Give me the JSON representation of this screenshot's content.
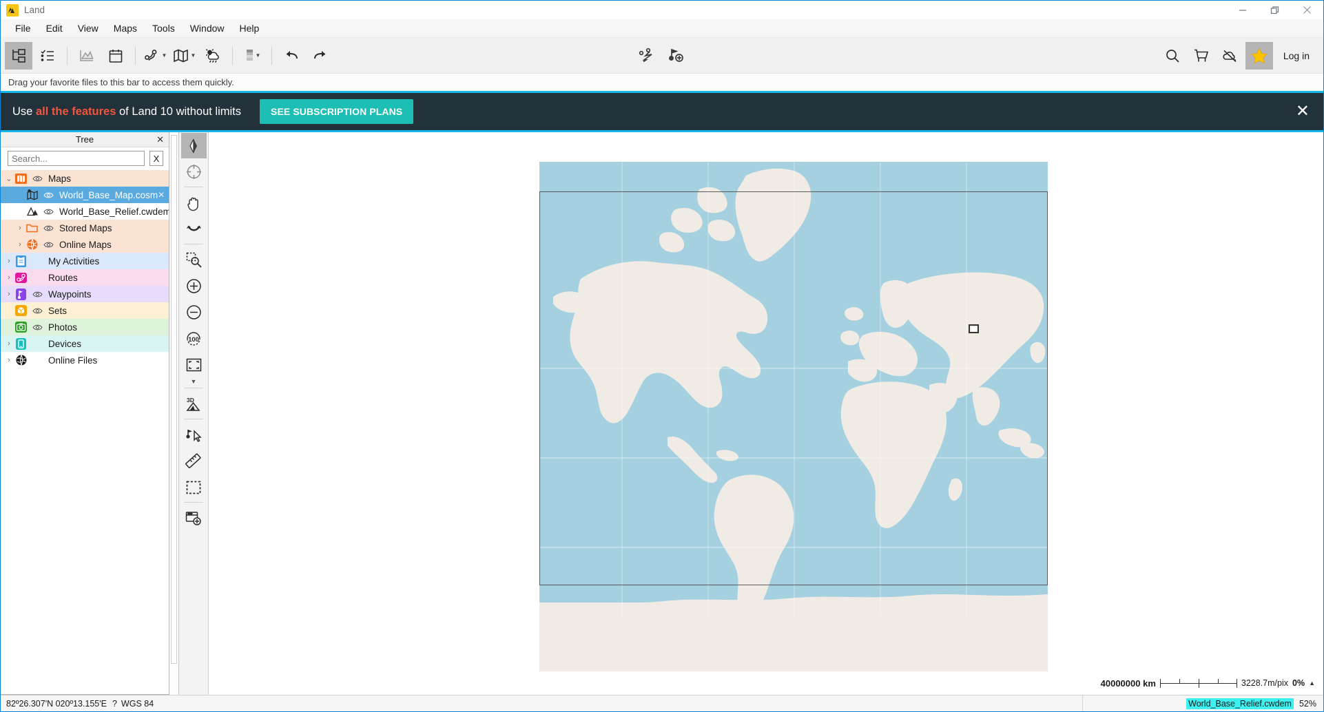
{
  "window": {
    "title": "Land",
    "app_icon": "land-mountain-icon",
    "controls": {
      "minimize": "—",
      "maximize": "❐",
      "close": "✕"
    }
  },
  "menubar": {
    "items": [
      {
        "label": "File",
        "name": "menu-file"
      },
      {
        "label": "Edit",
        "name": "menu-edit"
      },
      {
        "label": "View",
        "name": "menu-view"
      },
      {
        "label": "Maps",
        "name": "menu-maps"
      },
      {
        "label": "Tools",
        "name": "menu-tools"
      },
      {
        "label": "Window",
        "name": "menu-window"
      },
      {
        "label": "Help",
        "name": "menu-help"
      }
    ]
  },
  "toolbar": {
    "left": [
      {
        "icon": "tree-panel-icon",
        "active": true
      },
      {
        "icon": "checklist-icon",
        "active": false
      },
      {
        "icon": "elevation-graph-icon",
        "active": false
      },
      {
        "icon": "calendar-icon",
        "active": false
      },
      {
        "icon": "route-icon",
        "active": false,
        "caret": true
      },
      {
        "icon": "map-fold-icon",
        "active": false,
        "caret": true
      },
      {
        "icon": "weather-icon",
        "active": false
      },
      {
        "icon": "layers-opacity-icon",
        "active": false,
        "caret": true
      },
      {
        "icon": "undo-icon",
        "active": false
      },
      {
        "icon": "redo-icon",
        "active": false
      }
    ],
    "center": [
      {
        "icon": "create-route-icon"
      },
      {
        "icon": "add-waypoint-icon"
      }
    ],
    "right": [
      {
        "icon": "search-icon"
      },
      {
        "icon": "cart-icon"
      },
      {
        "icon": "cloud-offline-icon"
      },
      {
        "icon": "star-icon",
        "active": true
      }
    ],
    "login_label": "Log in"
  },
  "favbar": {
    "hint": "Drag your favorite files to this bar to access them quickly."
  },
  "promo": {
    "text_before": "Use ",
    "text_highlight": "all the features",
    "text_after": " of Land 10 without limits",
    "button_label": "SEE SUBSCRIPTION PLANS",
    "close_label": "✕",
    "bg_color": "#22313a",
    "accent_color": "#1dbfb4",
    "highlight_color": "#f2563d"
  },
  "tree": {
    "title": "Tree",
    "close_label": "✕",
    "search_placeholder": "Search...",
    "search_value": "",
    "clear_label": "X",
    "rows": [
      {
        "label": "Maps",
        "arrow": "⌄",
        "icon": "maps-folder-icon",
        "icon_color": "#f26b1c",
        "eye": true,
        "indent": 0,
        "bg": "#fbe3d4",
        "selected": false,
        "closable": false
      },
      {
        "label": "World_Base_Map.cosm",
        "arrow": "",
        "icon": "map-file-icon",
        "icon_color": "#2b2b2b",
        "eye": true,
        "indent": 1,
        "bg": "#5aaae0",
        "selected": true,
        "closable": true
      },
      {
        "label": "World_Base_Relief.cwdem",
        "arrow": "",
        "icon": "relief-file-icon",
        "icon_color": "#2b2b2b",
        "eye": true,
        "indent": 1,
        "bg": "#ffffff",
        "selected": false,
        "closable": false
      },
      {
        "label": "Stored Maps",
        "arrow": "›",
        "icon": "folder-icon",
        "icon_color": "#f26b1c",
        "eye": true,
        "indent": 1,
        "bg": "#fbe3d4",
        "selected": false,
        "closable": false
      },
      {
        "label": "Online Maps",
        "arrow": "›",
        "icon": "globe-orange-icon",
        "icon_color": "#f26b1c",
        "eye": true,
        "indent": 1,
        "bg": "#fbe3d4",
        "selected": false,
        "closable": false
      },
      {
        "label": "My Activities",
        "arrow": "›",
        "icon": "clipboard-icon",
        "icon_color": "#3b9ae1",
        "eye": false,
        "indent": 0,
        "bg": "#dbe8fb",
        "selected": false,
        "closable": false
      },
      {
        "label": "Routes",
        "arrow": "›",
        "icon": "routes-icon",
        "icon_color": "#e0179c",
        "eye": false,
        "indent": 0,
        "bg": "#fbdcec",
        "selected": false,
        "closable": false
      },
      {
        "label": "Waypoints",
        "arrow": "›",
        "icon": "waypoint-icon",
        "icon_color": "#8b44e8",
        "eye": true,
        "indent": 0,
        "bg": "#e7dcfb",
        "selected": false,
        "closable": false
      },
      {
        "label": "Sets",
        "arrow": "",
        "icon": "sets-box-icon",
        "icon_color": "#f5a700",
        "eye": true,
        "indent": 0,
        "bg": "#fdf0d4",
        "selected": false,
        "closable": false
      },
      {
        "label": "Photos",
        "arrow": "",
        "icon": "camera-icon",
        "icon_color": "#27a11f",
        "eye": true,
        "indent": 0,
        "bg": "#dff3dc",
        "selected": false,
        "closable": false
      },
      {
        "label": "Devices",
        "arrow": "›",
        "icon": "device-icon",
        "icon_color": "#18c0c0",
        "eye": false,
        "indent": 0,
        "bg": "#d9f5f3",
        "selected": false,
        "closable": false
      },
      {
        "label": "Online Files",
        "arrow": "›",
        "icon": "globe-black-icon",
        "icon_color": "#1a1a1a",
        "eye": false,
        "indent": 0,
        "bg": "#ffffff",
        "selected": false,
        "closable": false
      }
    ]
  },
  "map_tools": [
    {
      "icon": "compass-needle-icon",
      "active": true
    },
    {
      "icon": "center-target-icon",
      "active": false
    },
    {
      "sep": true
    },
    {
      "icon": "pan-hand-icon",
      "active": false
    },
    {
      "icon": "undo-view-icon",
      "active": false
    },
    {
      "sep": true
    },
    {
      "icon": "zoom-rectangle-icon",
      "active": false
    },
    {
      "icon": "zoom-in-icon",
      "active": false
    },
    {
      "icon": "zoom-out-icon",
      "active": false
    },
    {
      "icon": "zoom-100-icon",
      "active": false
    },
    {
      "icon": "fit-screen-icon",
      "active": false
    },
    {
      "caret": true
    },
    {
      "sep": true
    },
    {
      "icon": "3d-view-icon",
      "active": false
    },
    {
      "sep": true
    },
    {
      "icon": "select-pointer-icon",
      "active": false
    },
    {
      "icon": "measure-ruler-icon",
      "active": false
    },
    {
      "icon": "marquee-select-icon",
      "active": false
    },
    {
      "sep": true
    },
    {
      "icon": "new-window-icon",
      "active": false
    }
  ],
  "map": {
    "ocean_color": "#a5d0e0",
    "land_color": "#f0ece5",
    "border_color": "#c9a8a8",
    "frame_color": "#5a5a5a",
    "cursor_marker": "map-cursor-marker"
  },
  "scalebar": {
    "distance": "40000000 km",
    "resolution": "3228.7m/pix",
    "percent": "0%",
    "expander": "▲"
  },
  "statusbar": {
    "coordinates": "82º26.307'N 020º13.155'E",
    "help": "?",
    "datum": "WGS 84",
    "layer_name": "World_Base_Relief.cwdem",
    "layer_percent": "52%",
    "layer_highlight_color": "#3ff0f0"
  }
}
